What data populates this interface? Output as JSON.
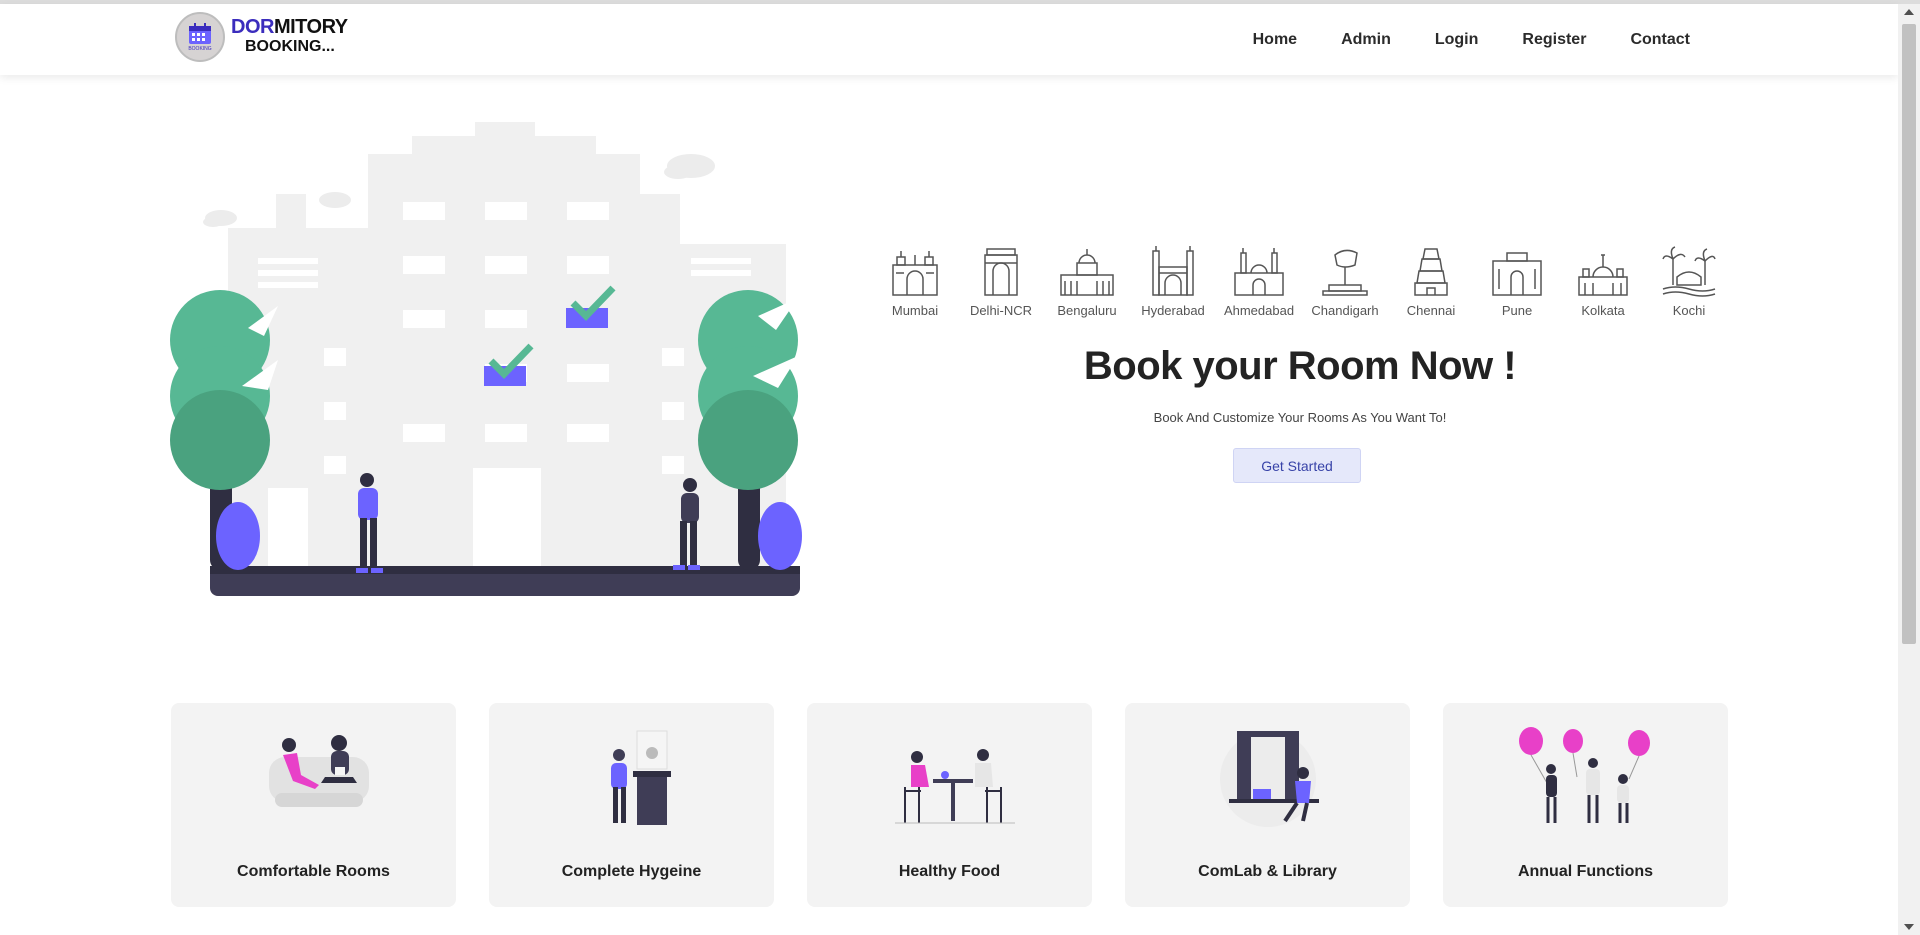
{
  "brand": {
    "line1_accent": "DOR",
    "line1_rest": "MITORY",
    "line2": "BOOKING...",
    "logo_badge": "BOOKING"
  },
  "nav": [
    "Home",
    "Admin",
    "Login",
    "Register",
    "Contact"
  ],
  "cities": [
    "Mumbai",
    "Delhi-NCR",
    "Bengaluru",
    "Hyderabad",
    "Ahmedabad",
    "Chandigarh",
    "Chennai",
    "Pune",
    "Kolkata",
    "Kochi"
  ],
  "hero": {
    "headline": "Book your Room Now !",
    "subline": "Book And Customize Your Rooms As You Want To!",
    "cta_label": "Get Started"
  },
  "features": [
    "Comfortable Rooms",
    "Complete Hygeine",
    "Healthy Food",
    "ComLab & Library",
    "Annual Functions"
  ],
  "colors": {
    "accent": "#6c63ff",
    "tree_green": "#57b894",
    "headline": "#232323",
    "cta_bg": "#e5e8fa"
  }
}
